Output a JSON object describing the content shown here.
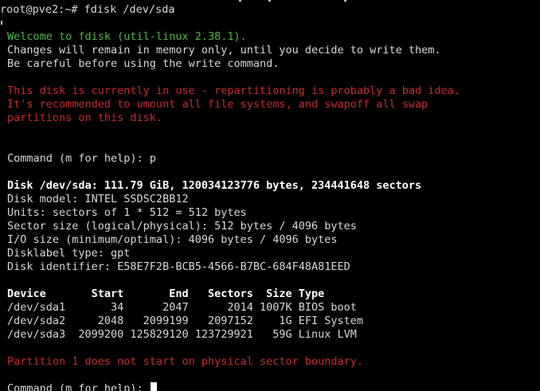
{
  "terminal": {
    "prompt_command": "root@pve2:~# fdisk /dev/sda",
    "welcome": "Welcome to fdisk (util-linux 2.38.1).",
    "changes_note": "Changes will remain in memory only, until you decide to write them.",
    "careful_note": "Be careful before using the write command.",
    "warning_line1": "This disk is currently in use - repartitioning is probably a bad idea.",
    "warning_line2": "It's recommended to umount all file systems, and swapoff all swap",
    "warning_line3": "partitions on this disk.",
    "command_p": "Command (m for help): p",
    "disk_info": {
      "summary": "Disk /dev/sda: 111.79 GiB, 120034123776 bytes, 234441648 sectors",
      "model": "Disk model: INTEL SSDSC2BB12",
      "units": "Units: sectors of 1 * 512 = 512 bytes",
      "sector_size": "Sector size (logical/physical): 512 bytes / 4096 bytes",
      "io_size": "I/O size (minimum/optimal): 4096 bytes / 4096 bytes",
      "label_type": "Disklabel type: gpt",
      "identifier": "Disk identifier: E58E7F2B-BCB5-4566-B7BC-684F48A81EED"
    },
    "partition_table": {
      "header": "Device       Start       End   Sectors  Size Type",
      "rows": [
        "/dev/sda1       34      2047      2014 1007K BIOS boot",
        "/dev/sda2     2048   2099199   2097152    1G EFI System",
        "/dev/sda3  2099200 125829120 123729921   59G Linux LVM"
      ]
    },
    "boundary_warning": "Partition 1 does not start on physical sector boundary.",
    "command_prompt": "Command (m for help): "
  },
  "colors": {
    "background": "#000000",
    "text": "#d8d8d8",
    "green": "#4cb944",
    "red": "#c62a2a",
    "bold": "#ffffff"
  }
}
